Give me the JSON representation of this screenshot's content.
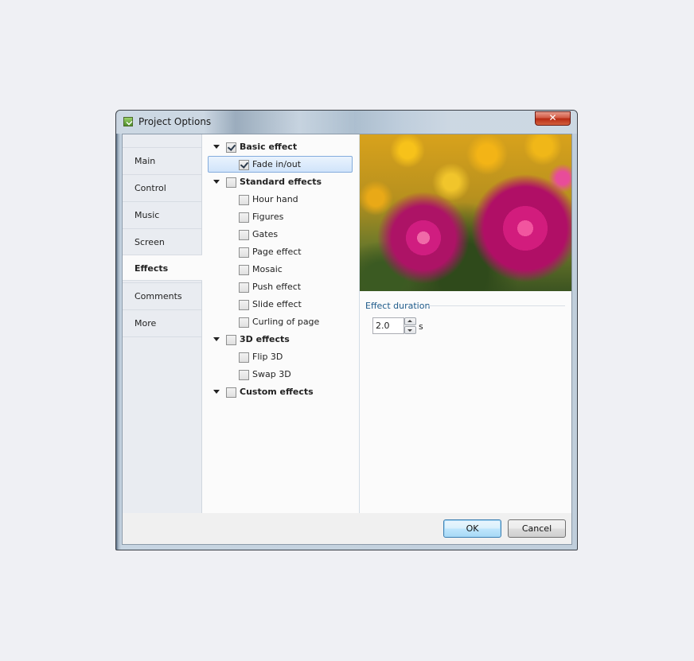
{
  "window": {
    "title": "Project Options",
    "close_label": "✕"
  },
  "sidebar": {
    "items": [
      {
        "label": "Main"
      },
      {
        "label": "Control"
      },
      {
        "label": "Music"
      },
      {
        "label": "Screen"
      },
      {
        "label": "Effects",
        "active": true
      },
      {
        "label": "Comments"
      },
      {
        "label": "More"
      }
    ]
  },
  "tree": {
    "basic": {
      "label": "Basic effect",
      "checked": true
    },
    "fade": {
      "label": "Fade in/out",
      "checked": true,
      "selected": true
    },
    "standard": {
      "label": "Standard effects",
      "checked": false
    },
    "hour_hand": {
      "label": "Hour hand",
      "checked": false
    },
    "figures": {
      "label": "Figures",
      "checked": false
    },
    "gates": {
      "label": "Gates",
      "checked": false
    },
    "page_effect": {
      "label": "Page effect",
      "checked": false
    },
    "mosaic": {
      "label": "Mosaic",
      "checked": false
    },
    "push_effect": {
      "label": "Push effect",
      "checked": false
    },
    "slide_effect": {
      "label": "Slide effect",
      "checked": false
    },
    "curling": {
      "label": "Curling of page",
      "checked": false
    },
    "three_d": {
      "label": "3D effects",
      "checked": false
    },
    "flip": {
      "label": "Flip 3D",
      "checked": false
    },
    "swap": {
      "label": "Swap 3D",
      "checked": false
    },
    "custom": {
      "label": "Custom effects",
      "checked": false
    }
  },
  "effect_duration": {
    "group_label": "Effect duration",
    "value": "2.0",
    "unit": "s"
  },
  "footer": {
    "ok_label": "OK",
    "cancel_label": "Cancel"
  }
}
